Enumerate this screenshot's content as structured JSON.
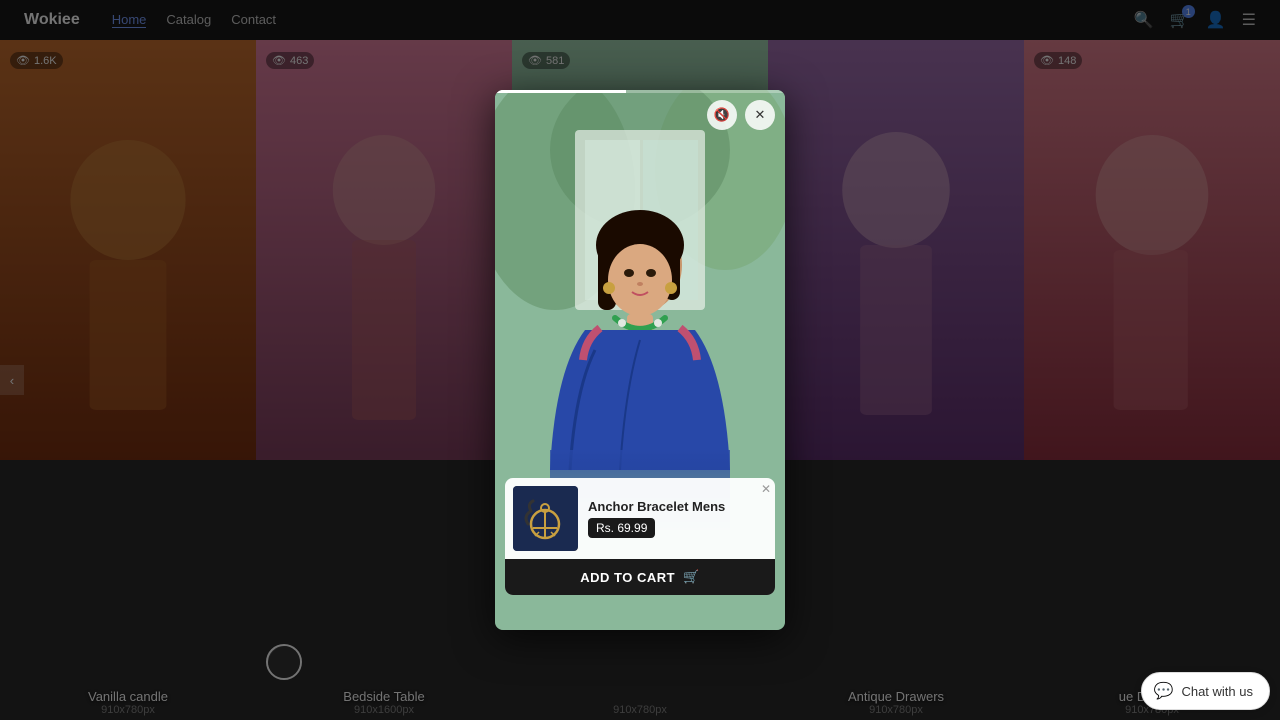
{
  "navbar": {
    "brand": "Wokiee",
    "links": [
      {
        "label": "Home",
        "active": true
      },
      {
        "label": "Catalog",
        "active": false
      },
      {
        "label": "Contact",
        "active": false
      }
    ],
    "cart_count": "1"
  },
  "grid": {
    "items": [
      {
        "id": 1,
        "views": "1.6K",
        "label": "Vanilla candle",
        "size": "910x780px",
        "color_top": "#c07030",
        "color_bottom": "#8a4010"
      },
      {
        "id": 2,
        "views": "463",
        "label": "Bedside Table",
        "size": "910x1600px",
        "color_top": "#d06080",
        "color_bottom": "#903050"
      },
      {
        "id": 3,
        "views": "581",
        "label": "",
        "size": "910x780px",
        "color_top": "#8abe9a",
        "color_bottom": "#4a7a5a"
      },
      {
        "id": 4,
        "views": "",
        "label": "Antique Drawers",
        "size": "910x780px",
        "color_top": "#9060a0",
        "color_bottom": "#603070"
      },
      {
        "id": 5,
        "views": "148",
        "label": "ue Drawers",
        "size": "910x780px",
        "color_top": "#d05060",
        "color_bottom": "#900030"
      }
    ]
  },
  "modal": {
    "product": {
      "name": "Anchor Bracelet Mens",
      "price": "Rs. 69.99",
      "add_to_cart": "ADD TO CART"
    }
  },
  "arrows": {
    "left": "‹",
    "right": "›"
  },
  "chat": {
    "label": "Chat with us"
  }
}
